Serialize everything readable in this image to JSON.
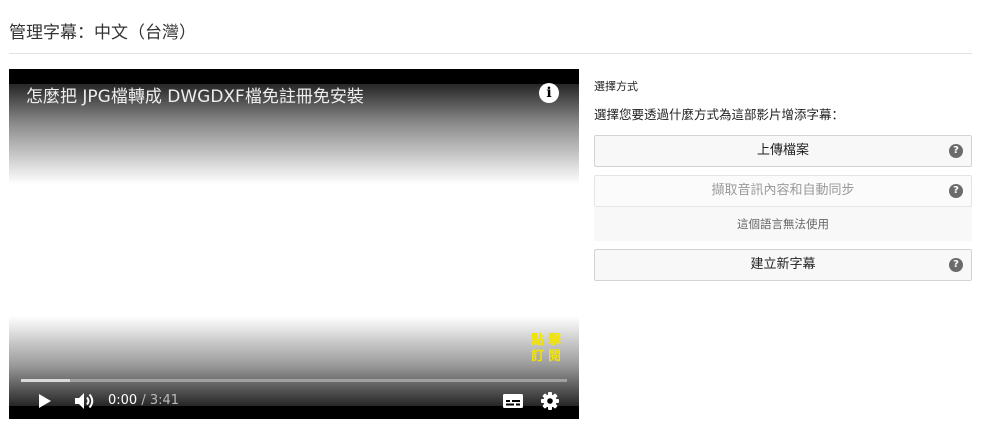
{
  "header": {
    "title": "管理字幕：中文（台灣）"
  },
  "player": {
    "video_title": "怎麼把 JPG檔轉成 DWGDXF檔免註冊免安裝",
    "info_icon": "i",
    "watermark": "點擊訂閱",
    "watermark_color": "#f2e400",
    "current_time": "0:00",
    "time_separator": " / ",
    "duration": "3:41",
    "progress_fraction": 0,
    "buffered_fraction": 0.09
  },
  "panel": {
    "heading": "選擇方式",
    "instruction": "選擇您要透過什麼方式為這部影片增添字幕：",
    "options": [
      {
        "label": "上傳檔案",
        "help": "?"
      },
      {
        "label": "擷取音訊內容和自動同步",
        "help": "?"
      },
      {
        "label": "建立新字幕",
        "help": "?"
      }
    ],
    "unavailable_note": "這個語言無法使用"
  },
  "icons": {
    "info": "info-icon",
    "play": "play-icon",
    "volume": "volume-icon",
    "captions": "captions-icon",
    "settings": "gear-icon",
    "help": "help-icon"
  }
}
